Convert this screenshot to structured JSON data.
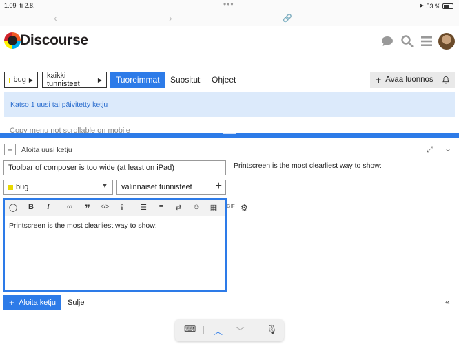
{
  "status": {
    "time": "1.09",
    "date": "ti 2.8.",
    "battery": "53 %"
  },
  "header": {
    "logo": "Discourse",
    "icons": [
      "chat-icon",
      "search-icon",
      "menu-icon",
      "avatar"
    ]
  },
  "filters": {
    "category": "bug",
    "tags": "kaikki tunnisteet",
    "tabs": [
      "Tuoreimmat",
      "Suositut",
      "Ohjeet"
    ],
    "active_tab": "Tuoreimmat",
    "new_topic": "Avaa luonnos"
  },
  "notice": "Katso 1 uusi tai päivitetty ketju",
  "behind_row": "Copy menu not scrollable on mobile",
  "composer": {
    "action": "Aloita uusi ketju",
    "title_value": "Toolbar of composer is too wide (at least on iPad)",
    "category": "bug",
    "tags_placeholder": "valinnaiset tunnisteet",
    "body": "Printscreen is the most clearliest way to show:",
    "preview": "Printscreen is the most clearliest way to show:",
    "submit": "Aloita ketju",
    "cancel": "Sulje"
  },
  "colors": {
    "accent": "#2d7be8",
    "notice_bg": "#dceafb",
    "category": "#e8d800"
  }
}
